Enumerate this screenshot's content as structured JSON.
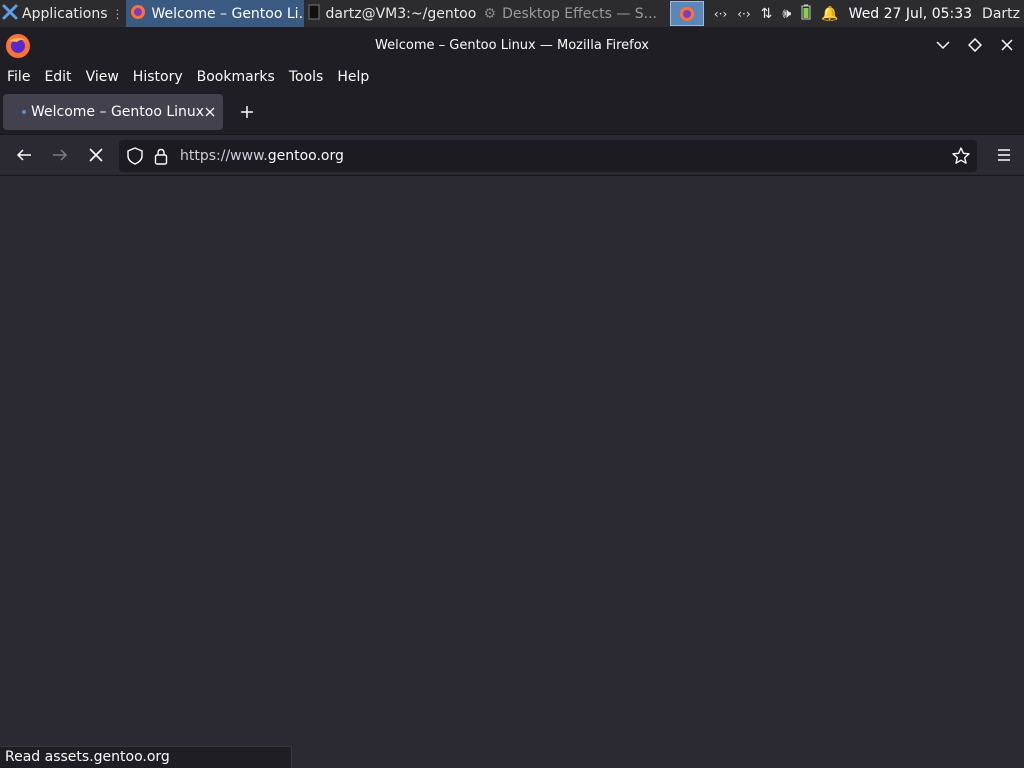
{
  "panel": {
    "applications_label": "Applications",
    "tasks": [
      {
        "label": "Welcome – Gentoo Li..."
      },
      {
        "label": "dartz@VM3:~/gentoo"
      },
      {
        "label": "Desktop Effects  — S..."
      }
    ],
    "clock": "Wed 27 Jul, 05:33",
    "user": "Dartz"
  },
  "window": {
    "title": "Welcome – Gentoo Linux — Mozilla Firefox"
  },
  "menubar": {
    "file": "File",
    "edit": "Edit",
    "view": "View",
    "history": "History",
    "bookmarks": "Bookmarks",
    "tools": "Tools",
    "help": "Help"
  },
  "tab": {
    "title": "Welcome – Gentoo Linux"
  },
  "url": {
    "prefix": "https://www.",
    "domain": "gentoo.org"
  },
  "status": {
    "text": "Read assets.gentoo.org"
  },
  "colors": {
    "accent": "#5b87b8",
    "chrome_bg": "#1f1e25",
    "content_bg": "#2b2a33"
  }
}
